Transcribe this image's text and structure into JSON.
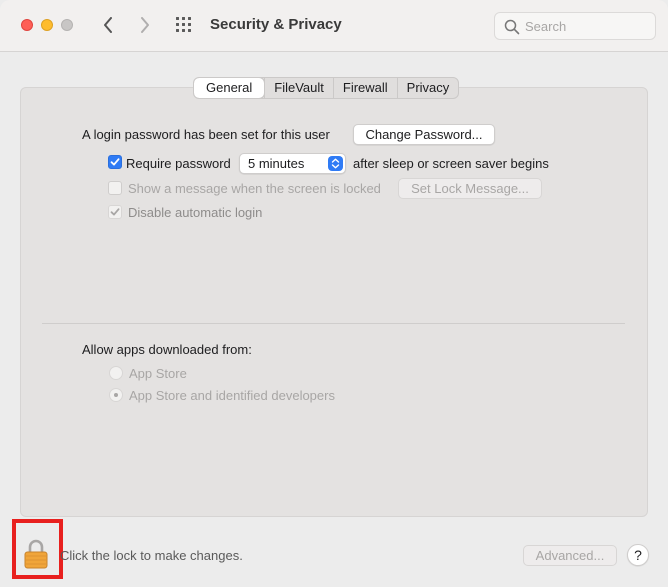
{
  "window": {
    "title": "Security & Privacy",
    "search_placeholder": "Search"
  },
  "tabs": [
    {
      "label": "General",
      "active": true
    },
    {
      "label": "FileVault",
      "active": false
    },
    {
      "label": "Firewall",
      "active": false
    },
    {
      "label": "Privacy",
      "active": false
    }
  ],
  "general": {
    "login_message": "A login password has been set for this user",
    "change_password_label": "Change Password...",
    "require_password_label": "Require password",
    "require_password_checked": true,
    "require_password_interval": "5 minutes",
    "after_sleep_label": "after sleep or screen saver begins",
    "show_message_label": "Show a message when the screen is locked",
    "show_message_checked": false,
    "set_lock_message_label": "Set Lock Message...",
    "disable_auto_login_label": "Disable automatic login",
    "disable_auto_login_checked": true
  },
  "allow_apps": {
    "heading": "Allow apps downloaded from:",
    "options": [
      {
        "label": "App Store",
        "selected": false
      },
      {
        "label": "App Store and identified developers",
        "selected": true
      }
    ]
  },
  "footer": {
    "lock_text": "Click the lock to make changes.",
    "advanced_label": "Advanced...",
    "help_label": "?"
  },
  "colors": {
    "accent": "#2f7bf5",
    "close": "#fe5f57",
    "minimize": "#febc2e",
    "highlight": "#e8201e"
  }
}
